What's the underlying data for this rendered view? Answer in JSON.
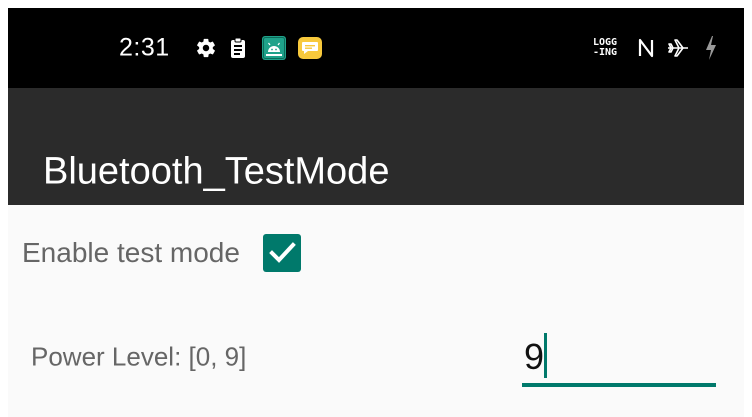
{
  "status_bar": {
    "time": "2:31",
    "left_icons": [
      "gear-icon",
      "clipboard-icon",
      "android-debug-icon",
      "message-icon"
    ],
    "right_icons": [
      "logging-indicator",
      "nfc-icon",
      "airplane-mode-icon",
      "charging-bolt-icon"
    ],
    "logging_line1": "LOGG",
    "logging_line2": "-ING"
  },
  "app_bar": {
    "title": "Bluetooth_TestMode"
  },
  "settings": {
    "test_mode": {
      "label": "Enable test mode",
      "checked": true
    },
    "power_level": {
      "label": "Power Level: [0, 9]",
      "value": "9"
    }
  },
  "colors": {
    "status_bar_bg": "#000000",
    "app_bar_bg": "#2b2b2b",
    "accent": "#00796b",
    "content_bg": "#fafafa",
    "label_text": "#666666"
  }
}
